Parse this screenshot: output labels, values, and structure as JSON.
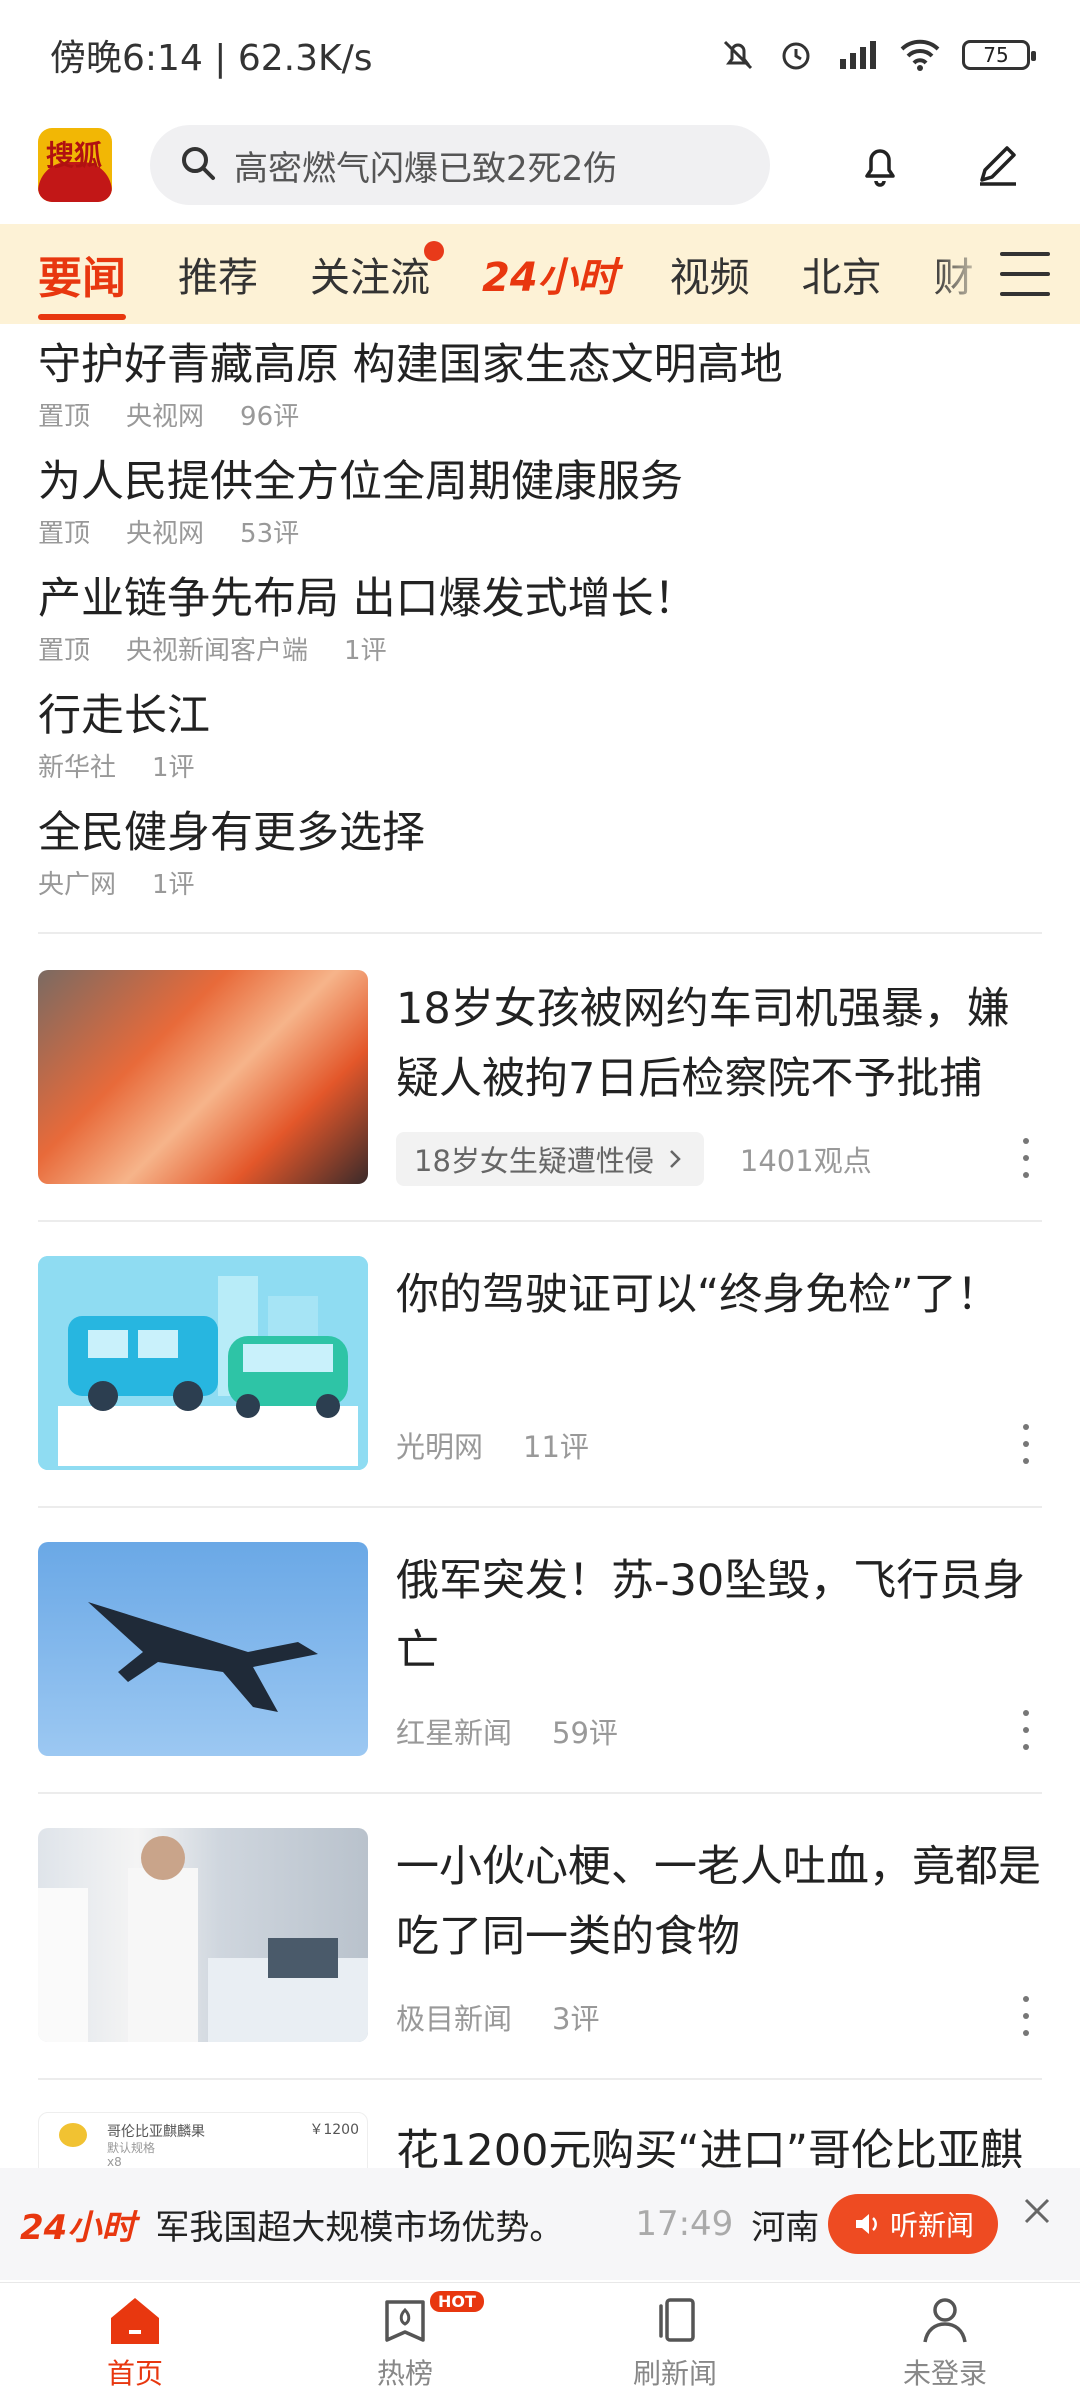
{
  "status_bar": {
    "time_speed": "傍晚6:14 | 62.3K/s",
    "battery": "75"
  },
  "header": {
    "search_placeholder": "高密燃气闪爆已致2死2伤",
    "logo_text": "搜狐"
  },
  "tabs": [
    "要闻",
    "推荐",
    "关注流",
    "24小时",
    "视频",
    "北京",
    "财"
  ],
  "top_stories": [
    {
      "title": "守护好青藏高原 构建国家生态文明高地",
      "meta": [
        "置顶",
        "央视网",
        "96评"
      ]
    },
    {
      "title": "为人民提供全方位全周期健康服务",
      "meta": [
        "置顶",
        "央视网",
        "53评"
      ]
    },
    {
      "title": "产业链争先布局 出口爆发式增长！",
      "meta": [
        "置顶",
        "央视新闻客户端",
        "1评"
      ]
    },
    {
      "title": "行走长江",
      "meta": [
        "新华社",
        "1评"
      ]
    },
    {
      "title": "全民健身有更多选择",
      "meta": [
        "央广网",
        "1评"
      ]
    }
  ],
  "cards": [
    {
      "title": "18岁女孩被网约车司机强暴，嫌疑人被拘7日后检察院不予批捕",
      "tag": "18岁女生疑遭性侵",
      "meta": [
        "1401观点"
      ],
      "thumb": "clothing-photo"
    },
    {
      "title": "你的驾驶证可以“终身免检”了！",
      "meta": [
        "光明网",
        "11评"
      ],
      "thumb": "cars-illustration"
    },
    {
      "title": "俄军突发！苏-30坠毁，飞行员身亡",
      "meta": [
        "红星新闻",
        "59评"
      ],
      "thumb": "jet-photo"
    },
    {
      "title": "一小伙心梗、一老人吐血，竟都是吃了同一类的食物",
      "meta": [
        "极目新闻",
        "3评"
      ],
      "thumb": "hospital-photo"
    },
    {
      "title": "花1200元购买“进口”哥伦比亚麒",
      "meta": [],
      "thumb": "product-photo",
      "thumb_text": [
        "哥伦比亚麒麟果",
        "默认规格",
        "x8",
        "￥1200"
      ]
    }
  ],
  "breaking": {
    "logo": "24小时",
    "text": "军我国超大规模市场优势。",
    "time": "17:49",
    "location": "河南",
    "listen_label": "听新闻"
  },
  "bottom_nav": [
    {
      "label": "首页"
    },
    {
      "label": "热榜",
      "badge": "HOT"
    },
    {
      "label": "刷新闻"
    },
    {
      "label": "未登录"
    }
  ],
  "colors": {
    "accent": "#e8370f",
    "tab_bg": "#fdf2d6"
  }
}
